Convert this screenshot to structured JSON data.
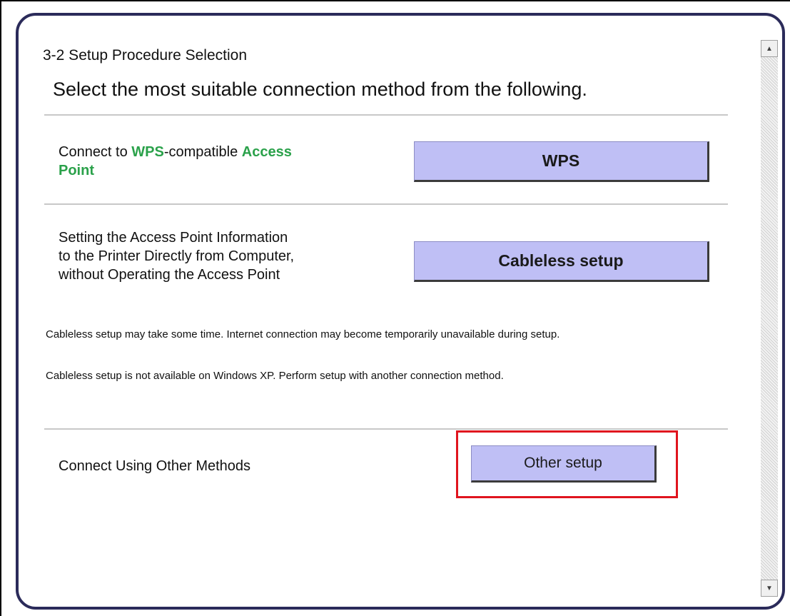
{
  "header": {
    "step_title": "3-2 Setup Procedure Selection",
    "subtitle": "Select the most suitable connection method from the following."
  },
  "wps_row": {
    "label_part1": "Connect to ",
    "label_accent1": "WPS",
    "label_part2": "-compatible ",
    "label_accent2": "Access",
    "label_accent3": "Point",
    "button_label": "WPS"
  },
  "cableless_row": {
    "label_line1": "Setting the Access Point Information",
    "label_line2": "to the Printer Directly from Computer,",
    "label_line3": "without Operating the Access Point",
    "button_label": "Cableless setup",
    "note1": "Cableless setup may take some time. Internet connection may become temporarily unavailable during setup.",
    "note2": "Cableless setup is not available on Windows XP. Perform setup with another connection method."
  },
  "other_row": {
    "label": "Connect Using Other Methods",
    "button_label": "Other setup"
  },
  "scrollbar": {
    "up_glyph": "▲",
    "down_glyph": "▼"
  },
  "colors": {
    "accent_green": "#2aa14a",
    "button_fill": "#bfbff5",
    "highlight_red": "#e0141e",
    "frame": "#2b2b5a"
  }
}
